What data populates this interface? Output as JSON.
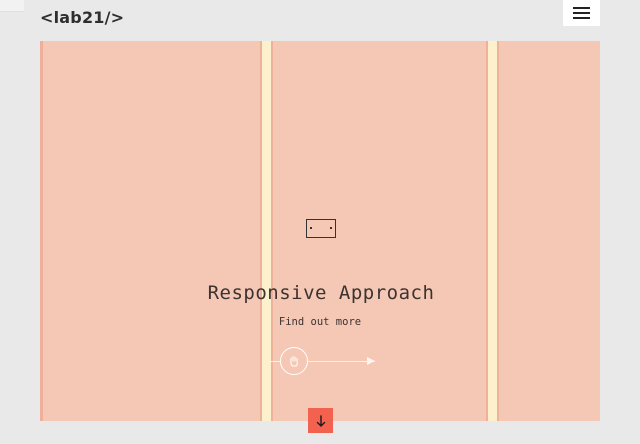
{
  "header": {
    "logo": "<lab21/>",
    "menu_icon": "hamburger-menu-icon"
  },
  "hero": {
    "title": "Responsive Approach",
    "link_label": "Find out more",
    "center_icon": "device-icon",
    "cta_icon": "hand-pointer-icon",
    "background_color": "#f4c8b5",
    "stripe_color": "#fdf0cd"
  },
  "scroll": {
    "icon": "arrow-down-icon",
    "glyph": "↓",
    "color": "#f2624e"
  }
}
